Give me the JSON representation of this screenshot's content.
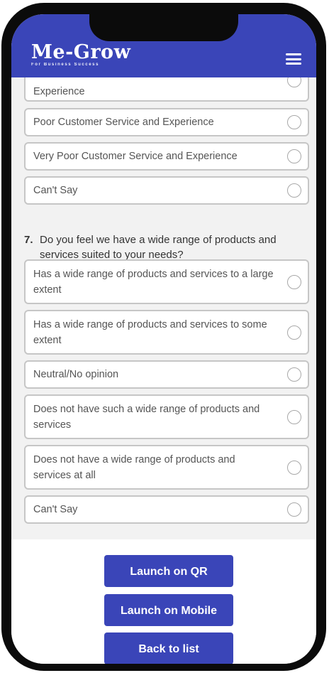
{
  "app": {
    "logo_text": "Me-Grow",
    "logo_tagline": "For Business Success"
  },
  "colors": {
    "brand": "#3a45b8",
    "background": "#f2f2f2",
    "option_border": "#c6c6c6"
  },
  "icons": {
    "menu": "hamburger-menu-icon",
    "radio": "radio-unselected-icon"
  },
  "previous_question": {
    "options": [
      {
        "label": "Experience"
      },
      {
        "label": "Poor Customer Service and Experience"
      },
      {
        "label": "Very Poor Customer Service and Experience"
      },
      {
        "label": "Can't Say"
      }
    ]
  },
  "question": {
    "number": "7.",
    "text": "Do you feel we have a wide range of products and services suited to your needs?",
    "options": [
      {
        "label": "Has a wide range of products and services to a large extent"
      },
      {
        "label": "Has a wide range of products and services to some extent"
      },
      {
        "label": "Neutral/No opinion"
      },
      {
        "label": "Does not have such a wide range of products and services"
      },
      {
        "label": "Does not have a wide range of products and services at all"
      },
      {
        "label": "Can't Say"
      }
    ]
  },
  "actions": {
    "launch_qr": "Launch on QR",
    "launch_mobile": "Launch on Mobile",
    "back_to_list": "Back to list"
  }
}
